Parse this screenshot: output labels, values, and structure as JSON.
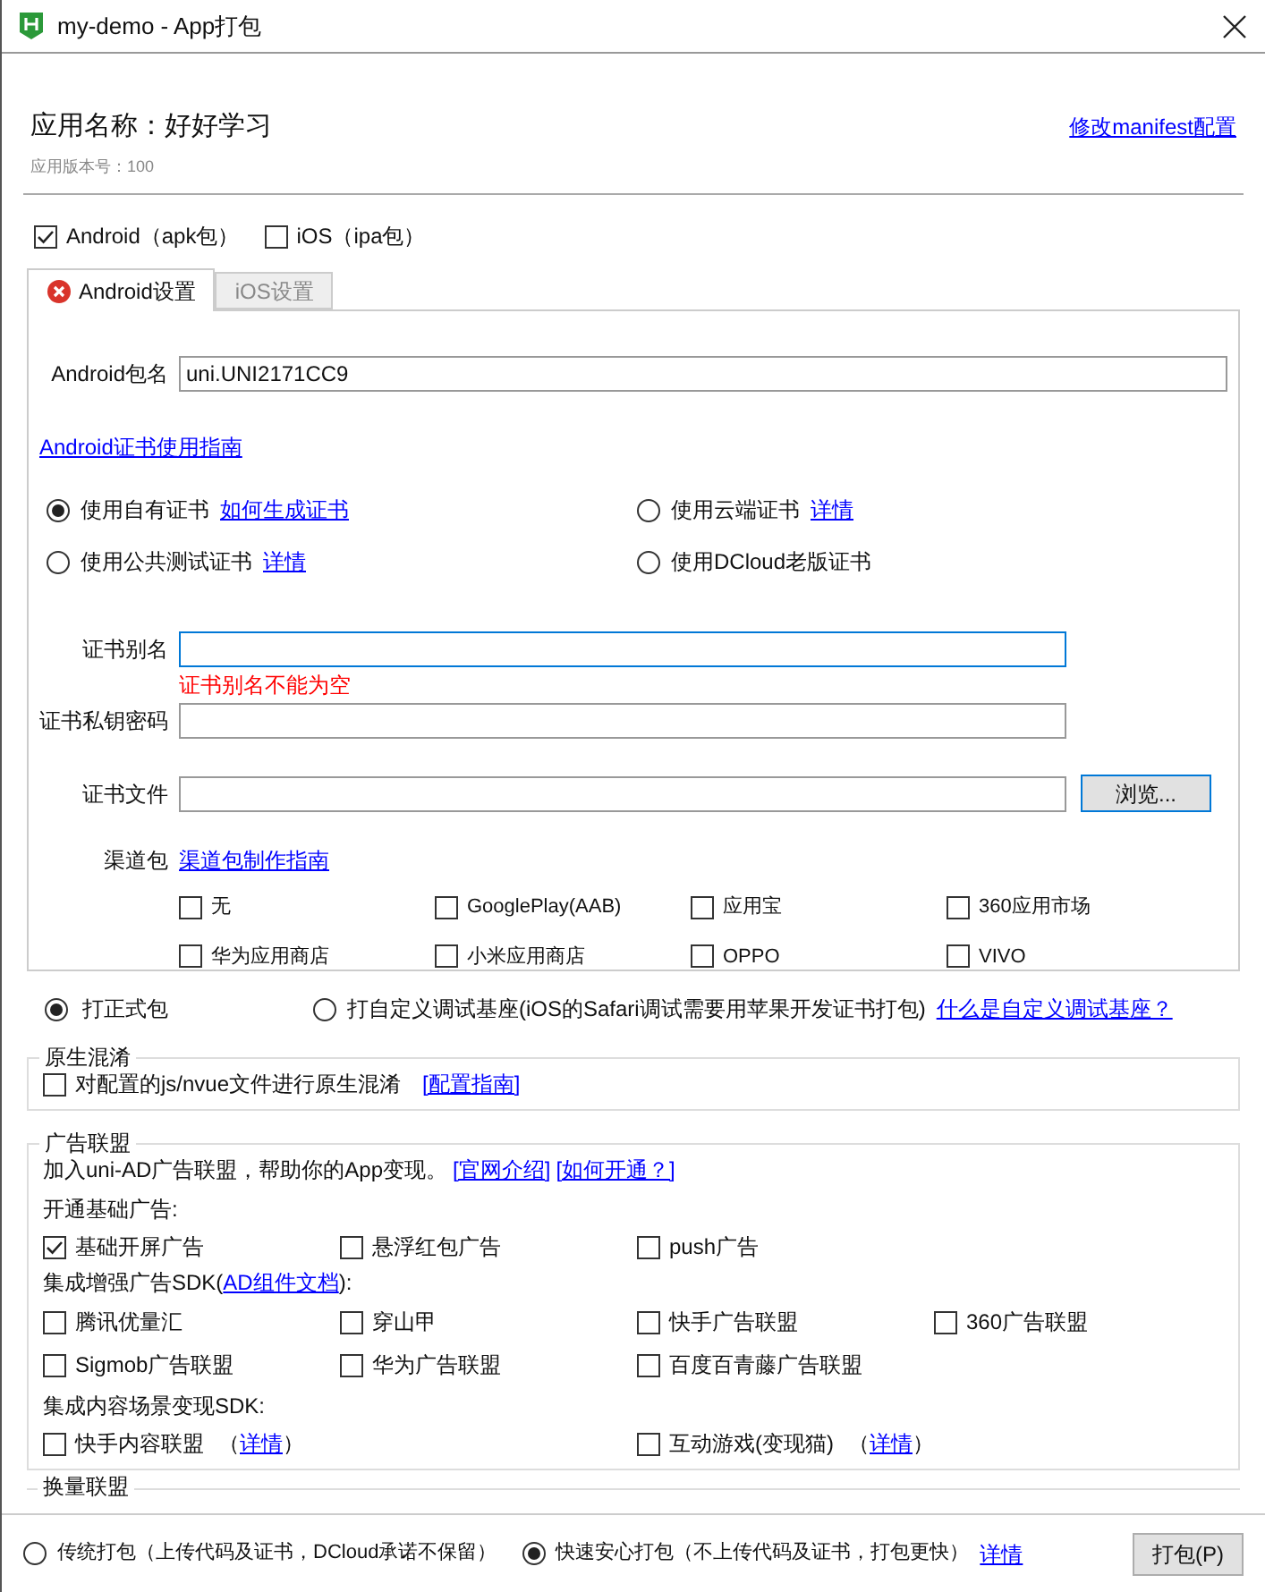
{
  "window": {
    "title": "my-demo - App打包"
  },
  "app": {
    "name": "应用名称：好好学习",
    "version": "应用版本号：100",
    "manifest_link": "修改manifest配置"
  },
  "platforms": [
    {
      "label": "Android（apk包）",
      "checked": true
    },
    {
      "label": "iOS（ipa包）",
      "checked": false
    }
  ],
  "tabs": [
    {
      "label": "Android设置",
      "selected": true,
      "error": true
    },
    {
      "label": "iOS设置",
      "selected": false,
      "error": false
    }
  ],
  "android": {
    "package_label": "Android包名",
    "package_value": "uni.UNI2171CC9",
    "cert_guide_link": "Android证书使用指南",
    "cert_options": [
      {
        "label": "使用自有证书",
        "link": "如何生成证书",
        "selected": true
      },
      {
        "label": "使用云端证书",
        "link": "详情",
        "selected": false
      },
      {
        "label": "使用公共测试证书",
        "link": "详情",
        "selected": false
      },
      {
        "label": "使用DCloud老版证书",
        "selected": false
      }
    ],
    "fields": [
      {
        "label": "证书别名",
        "focused": true,
        "error": "证书别名不能为空"
      },
      {
        "label": "证书私钥密码",
        "focused": false
      },
      {
        "label": "证书文件",
        "focused": false,
        "button": "浏览..."
      }
    ],
    "channel_label": "渠道包",
    "channel_link": "渠道包制作指南",
    "channels": [
      {
        "label": "无",
        "checked": false
      },
      {
        "label": "GooglePlay(AAB)",
        "checked": false
      },
      {
        "label": "应用宝",
        "checked": false
      },
      {
        "label": "360应用市场",
        "checked": false
      },
      {
        "label": "华为应用商店",
        "checked": false
      },
      {
        "label": "小米应用商店",
        "checked": false
      },
      {
        "label": "OPPO",
        "checked": false
      },
      {
        "label": "VIVO",
        "checked": false
      }
    ]
  },
  "build_types": [
    {
      "label": "打正式包",
      "selected": true
    },
    {
      "label": "打自定义调试基座(iOS的Safari调试需要用苹果开发证书打包)",
      "selected": false,
      "link": "什么是自定义调试基座？"
    }
  ],
  "obfuscation": {
    "title": "原生混淆",
    "option": {
      "label": "对配置的js/nvue文件进行原生混淆",
      "checked": false
    },
    "link": "[配置指南]"
  },
  "ads": {
    "title": "广告联盟",
    "intro": "加入uni-AD广告联盟，帮助你的App变现。",
    "links": [
      "[官网介绍]",
      "[如何开通？]"
    ],
    "basic_label": "开通基础广告:",
    "basic": [
      {
        "label": "基础开屏广告",
        "checked": true
      },
      {
        "label": "悬浮红包广告",
        "checked": false
      },
      {
        "label": "push广告",
        "checked": false
      }
    ],
    "enhanced_label": "集成增强广告SDK(",
    "enhanced_link": "AD组件文档",
    "enhanced_suffix": "):",
    "enhanced": [
      {
        "label": "腾讯优量汇",
        "checked": false
      },
      {
        "label": "穿山甲",
        "checked": false
      },
      {
        "label": "快手广告联盟",
        "checked": false
      },
      {
        "label": "360广告联盟",
        "checked": false
      },
      {
        "label": "Sigmob广告联盟",
        "checked": false
      },
      {
        "label": "华为广告联盟",
        "checked": false
      },
      {
        "label": "百度百青藤广告联盟",
        "checked": false
      }
    ],
    "content_label": "集成内容场景变现SDK:",
    "content": [
      {
        "label": "快手内容联盟",
        "checked": false,
        "prefix": "（",
        "link": "详情",
        "suffix": "）"
      },
      {
        "label": "互动游戏(变现猫)",
        "checked": false,
        "prefix": "（",
        "link": "详情",
        "suffix": "）"
      }
    ]
  },
  "exchange": {
    "title": "换量联盟"
  },
  "footer": {
    "modes": [
      {
        "label": "传统打包（上传代码及证书，DCloud承诺不保留）",
        "selected": false
      },
      {
        "label": "快速安心打包（不上传代码及证书，打包更快）",
        "selected": true
      }
    ],
    "link": "详情",
    "button": "打包(P)"
  }
}
